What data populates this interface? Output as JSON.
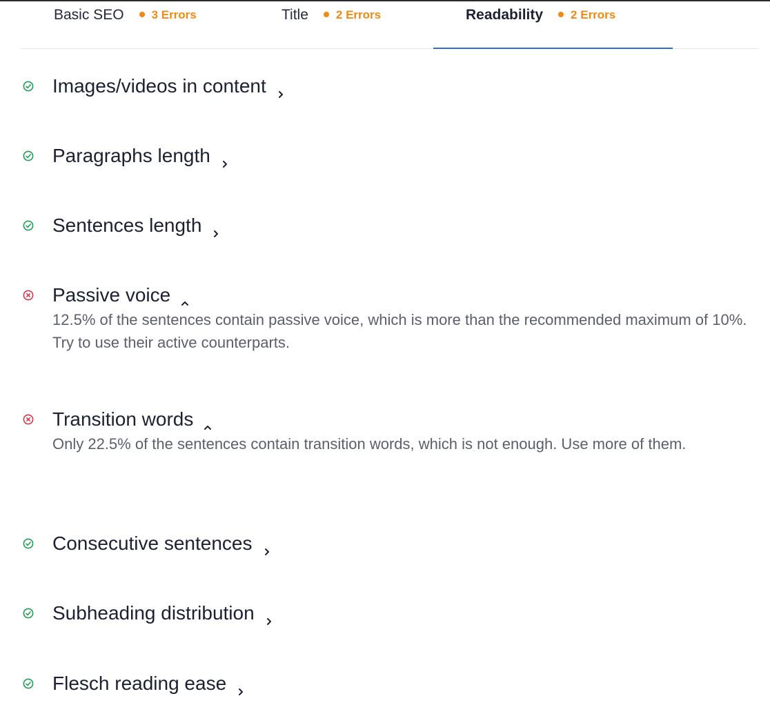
{
  "tabs": [
    {
      "label": "Basic SEO",
      "errors": "3 Errors",
      "active": false
    },
    {
      "label": "Title",
      "errors": "2 Errors",
      "active": false
    },
    {
      "label": "Readability",
      "errors": "2 Errors",
      "active": true
    }
  ],
  "checks": [
    {
      "title": "Images/videos in content",
      "status": "pass",
      "expanded": false,
      "description": ""
    },
    {
      "title": "Paragraphs length",
      "status": "pass",
      "expanded": false,
      "description": ""
    },
    {
      "title": "Sentences length",
      "status": "pass",
      "expanded": false,
      "description": ""
    },
    {
      "title": "Passive voice",
      "status": "fail",
      "expanded": true,
      "description": "12.5% of the sentences contain passive voice, which is more than the recommended maximum of 10%. Try to use their active counterparts."
    },
    {
      "title": "Transition words",
      "status": "fail",
      "expanded": true,
      "description": "Only 22.5% of the sentences contain transition words, which is not enough. Use more of them."
    },
    {
      "title": "Consecutive sentences",
      "status": "pass",
      "expanded": false,
      "description": ""
    },
    {
      "title": "Subheading distribution",
      "status": "pass",
      "expanded": false,
      "description": ""
    },
    {
      "title": "Flesch reading ease",
      "status": "pass",
      "expanded": false,
      "description": ""
    }
  ],
  "colors": {
    "pass": "#1f9d55",
    "fail": "#d63649",
    "error_badge": "#f08a12",
    "active_tab_underline": "#2d6fd1"
  },
  "icons": {
    "pass": "check-circle-icon",
    "fail": "x-circle-icon",
    "collapsed": "chevron-right-icon",
    "expanded": "chevron-up-icon"
  }
}
